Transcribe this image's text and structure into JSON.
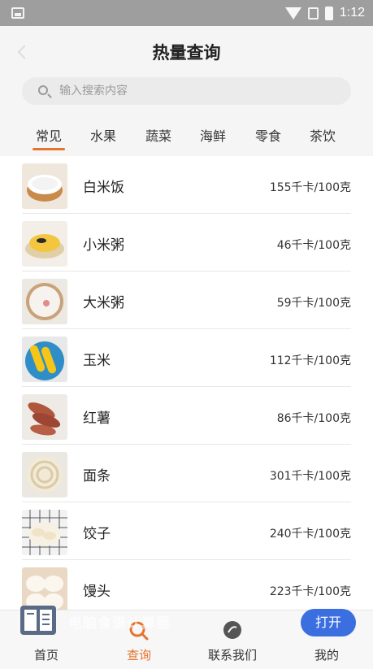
{
  "status_bar": {
    "time": "1:12"
  },
  "header": {
    "title": "热量查询"
  },
  "search": {
    "placeholder": "输入搜索内容"
  },
  "tabs": [
    {
      "label": "常见",
      "active": true
    },
    {
      "label": "水果",
      "active": false
    },
    {
      "label": "蔬菜",
      "active": false
    },
    {
      "label": "海鲜",
      "active": false
    },
    {
      "label": "零食",
      "active": false
    },
    {
      "label": "茶饮",
      "active": false
    }
  ],
  "foods": [
    {
      "name": "白米饭",
      "calories": "155千卡/100克",
      "icon": "rice-bowl-icon"
    },
    {
      "name": "小米粥",
      "calories": "46千卡/100克",
      "icon": "millet-porridge-icon"
    },
    {
      "name": "大米粥",
      "calories": "59千卡/100克",
      "icon": "rice-porridge-icon"
    },
    {
      "name": "玉米",
      "calories": "112千卡/100克",
      "icon": "corn-icon"
    },
    {
      "name": "红薯",
      "calories": "86千卡/100克",
      "icon": "sweet-potato-icon"
    },
    {
      "name": "面条",
      "calories": "301千卡/100克",
      "icon": "noodles-icon"
    },
    {
      "name": "饺子",
      "calories": "240千卡/100克",
      "icon": "dumplings-icon"
    },
    {
      "name": "馒头",
      "calories": "223千卡/100克",
      "icon": "steamed-bun-icon"
    }
  ],
  "bottom_nav": [
    {
      "label": "首页",
      "icon": "home-icon",
      "active": false
    },
    {
      "label": "查询",
      "icon": "search-nav-icon",
      "active": true
    },
    {
      "label": "联系我们",
      "icon": "contact-icon",
      "active": false
    },
    {
      "label": "我的",
      "icon": "profile-icon",
      "active": false
    }
  ],
  "banner": {
    "text": "电脑食谱计算器",
    "button_label": "打开"
  },
  "colors": {
    "accent": "#e6732e",
    "button_blue": "#3b6fe0",
    "background": "#f5f5f5"
  }
}
